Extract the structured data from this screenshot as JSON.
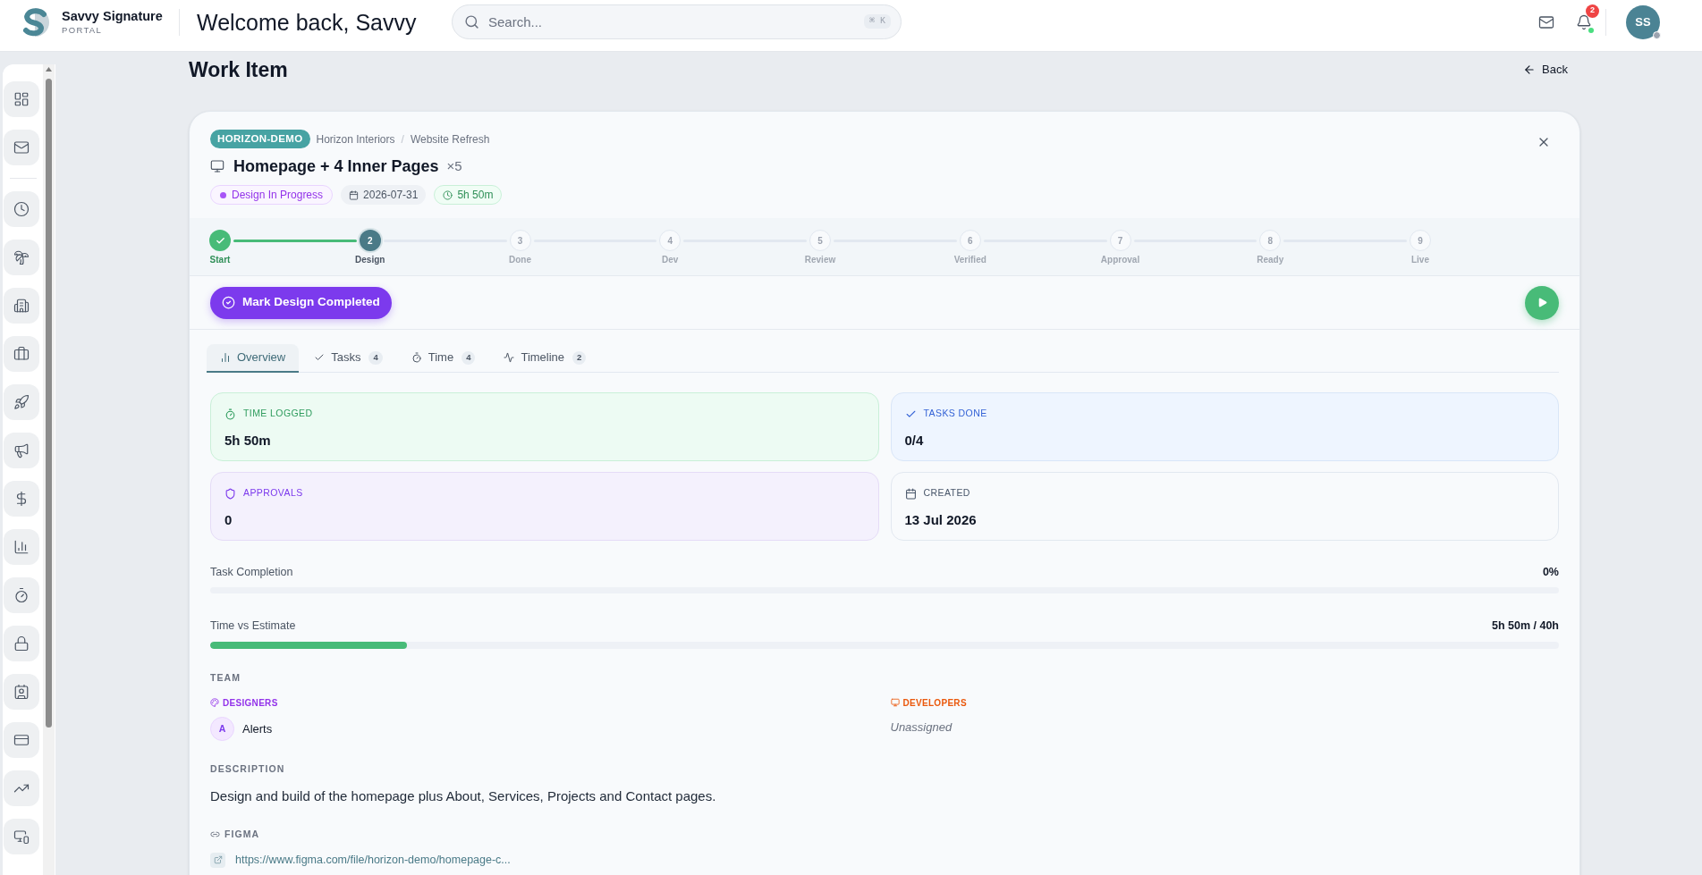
{
  "topbar": {
    "brand": {
      "name": "Savvy Signature",
      "subtitle": "PORTAL"
    },
    "greeting": "Welcome back, Savvy",
    "search": {
      "placeholder": "Search...",
      "shortcut": "⌘ K"
    },
    "notifications": {
      "count": "2"
    },
    "avatar": {
      "initials": "SS"
    }
  },
  "sidebar": {
    "groups": [
      {
        "items": [
          {
            "kind": "dashboard"
          },
          {
            "kind": "mail"
          }
        ]
      },
      {
        "items": [
          {
            "kind": "clock"
          },
          {
            "kind": "palm"
          },
          {
            "kind": "building"
          },
          {
            "kind": "briefcase"
          },
          {
            "kind": "rocket"
          },
          {
            "kind": "megaphone"
          },
          {
            "kind": "dollar"
          },
          {
            "kind": "chart"
          },
          {
            "kind": "timer"
          },
          {
            "kind": "lock"
          },
          {
            "kind": "contact"
          },
          {
            "kind": "card"
          },
          {
            "kind": "trend"
          },
          {
            "kind": "devices"
          }
        ]
      }
    ]
  },
  "page": {
    "title": "Work Item",
    "back": "Back"
  },
  "work_item": {
    "project_tag": "HORIZON-DEMO",
    "breadcrumb": {
      "items": [
        "Horizon Interiors",
        "Website Refresh"
      ],
      "separator": "/"
    },
    "title": "Homepage + 4 Inner Pages",
    "quantity": "×5",
    "chips": [
      {
        "kind": "status",
        "label": "Design In Progress"
      },
      {
        "kind": "due_date",
        "label": "2026-07-31"
      },
      {
        "kind": "time_spent",
        "label": "5h 50m"
      }
    ],
    "stepper": {
      "steps": [
        {
          "label": "Start",
          "completed": true,
          "current": false
        },
        {
          "number": "2",
          "label": "Design",
          "completed": false,
          "current": true
        },
        {
          "number": "3",
          "label": "Done",
          "completed": false,
          "current": false
        },
        {
          "number": "4",
          "label": "Dev",
          "completed": false,
          "current": false
        },
        {
          "number": "5",
          "label": "Review",
          "completed": false,
          "current": false
        },
        {
          "number": "6",
          "label": "Verified",
          "completed": false,
          "current": false
        },
        {
          "number": "7",
          "label": "Approval",
          "completed": false,
          "current": false
        },
        {
          "number": "8",
          "label": "Ready",
          "completed": false,
          "current": false
        },
        {
          "number": "9",
          "label": "Live",
          "completed": false,
          "current": false
        }
      ]
    },
    "primary_action": {
      "label": "Mark Design Completed"
    },
    "tabs": [
      {
        "kind": "overview",
        "label": "Overview",
        "selected": true
      },
      {
        "kind": "tasks",
        "label": "Tasks",
        "count": "4",
        "selected": false
      },
      {
        "kind": "time",
        "label": "Time",
        "count": "4",
        "selected": false
      },
      {
        "kind": "timeline",
        "label": "Timeline",
        "count": "2",
        "selected": false
      }
    ],
    "stats": [
      {
        "kind": "time",
        "label": "TIME LOGGED",
        "value": "5h 50m"
      },
      {
        "kind": "tasks",
        "label": "TASKS DONE",
        "value": "0/4"
      },
      {
        "kind": "approvals",
        "label": "APPROVALS",
        "value": "0"
      },
      {
        "kind": "created",
        "label": "CREATED",
        "value": "13 Jul 2026"
      }
    ],
    "progress": [
      {
        "label": "Task Completion",
        "reading": "0%"
      },
      {
        "label": "Time vs Estimate",
        "reading": "5h 50m / 40h",
        "level": 0.146
      }
    ],
    "team": {
      "title": "TEAM",
      "groups": [
        {
          "kind": "designers",
          "label": "DESIGNERS",
          "members": [
            {
              "initial": "A",
              "name": "Alerts"
            }
          ]
        },
        {
          "kind": "developers",
          "label": "DEVELOPERS",
          "empty_text": "Unassigned"
        }
      ]
    },
    "description": {
      "title": "DESCRIPTION",
      "text": "Design and build of the homepage plus About, Services, Projects and Contact pages."
    },
    "figma": {
      "title": "FIGMA",
      "url": "https://www.figma.com/file/horizon-demo/homepage-c..."
    }
  }
}
